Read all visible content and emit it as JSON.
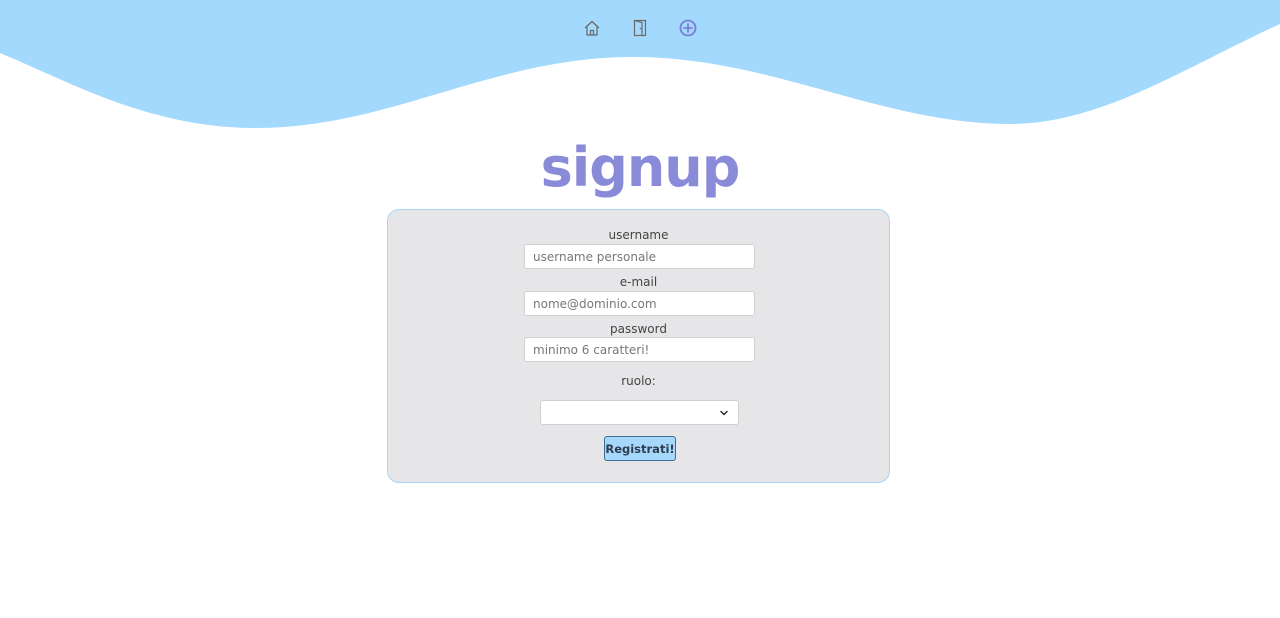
{
  "nav": {
    "items": [
      {
        "icon": "home-icon"
      },
      {
        "icon": "door-icon"
      },
      {
        "icon": "plus-circle-icon"
      }
    ]
  },
  "page": {
    "title": "signup"
  },
  "form": {
    "username": {
      "label": "username",
      "value": "",
      "placeholder": "username personale"
    },
    "email": {
      "label": "e-mail",
      "value": "",
      "placeholder": "nome@dominio.com"
    },
    "password": {
      "label": "password",
      "value": "",
      "placeholder": "minimo 6 caratteri!"
    },
    "role": {
      "label": "ruolo:",
      "selected": ""
    },
    "submit_label": "Registrati!"
  },
  "colors": {
    "wave": "#a3d9fc",
    "title": "#8a8bd8",
    "card_background": "#e6e6e8",
    "card_border": "#a7d6f7",
    "button_background": "#a5d8fb",
    "button_border": "#3f6e93"
  }
}
